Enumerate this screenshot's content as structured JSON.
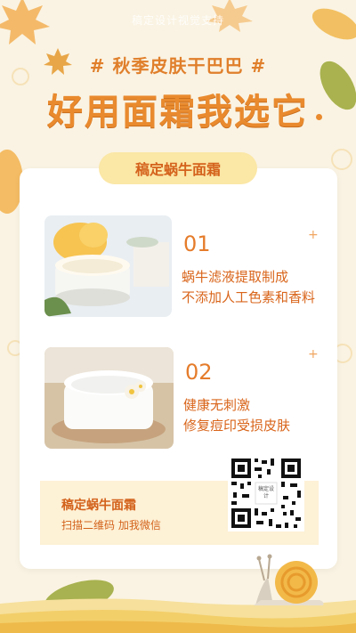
{
  "header": {
    "watermark": "稿定设计视觉支持",
    "hashtag": "# 秋季皮肤干巴巴 #",
    "title": "好用面霜我选它"
  },
  "card": {
    "pill_label": "稿定蜗牛面霜",
    "features": [
      {
        "number": "01",
        "line1": "蜗牛滤液提取制成",
        "line2": "不添加人工色素和香料"
      },
      {
        "number": "02",
        "line1": "健康无刺激",
        "line2": "修复痘印受损皮肤"
      }
    ],
    "promo": {
      "title": "稿定蜗牛面霜",
      "subtitle": "扫描二维码  加我微信",
      "qr_center_text": "稿定设计"
    }
  },
  "colors": {
    "background": "#faf3e3",
    "accent_orange": "#e98a2e",
    "text_orange": "#d9651b",
    "pill_yellow": "#fbe7a6",
    "promo_bg": "#fdf1d6"
  }
}
